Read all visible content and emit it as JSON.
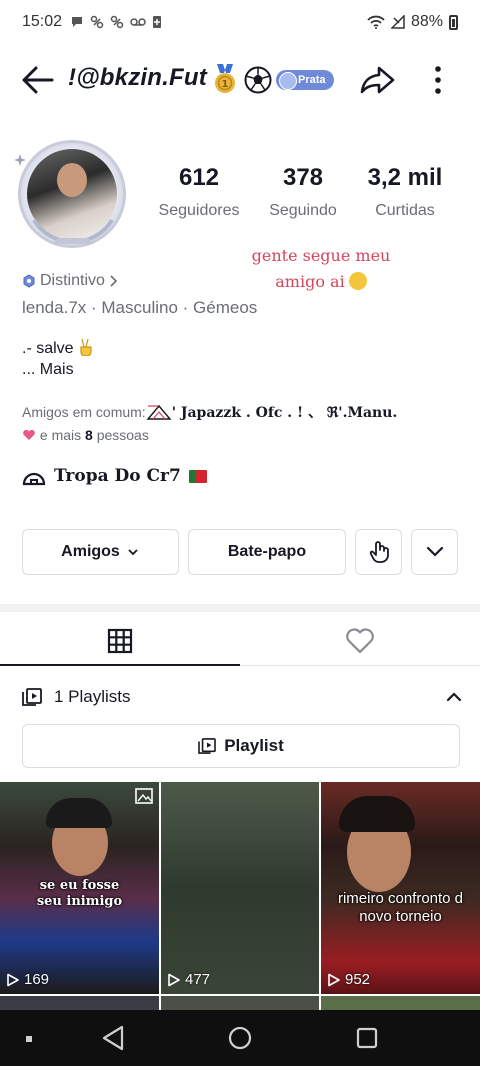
{
  "status_bar": {
    "time": "15:02",
    "notif_icons": [
      "chat-bubble-icon",
      "usb-icon",
      "usb-icon",
      "voicemail-icon",
      "battery-saver-icon"
    ],
    "battery": "88%"
  },
  "header": {
    "username": "!@bkzin.Fut",
    "rank_badge": "Prata"
  },
  "stats": [
    {
      "value": "612",
      "label": "Seguidores"
    },
    {
      "value": "378",
      "label": "Seguindo"
    },
    {
      "value": "3,2 mil",
      "label": "Curtidas"
    }
  ],
  "bio_note": {
    "line1": "gente segue meu",
    "line2": "amigo ai"
  },
  "distintivo": "Distintivo",
  "meta_line": "lenda.7x · Masculino · Gémeos",
  "bio": {
    "line1": ".- salve",
    "more": "...  Mais"
  },
  "mutual": {
    "prefix": "Amigos em comum:",
    "names": "' Japazzk . Ofc  . !       、 ℜ'.Manu.",
    "suffix_a": " e mais ",
    "count": "8",
    "suffix_b": " pessoas"
  },
  "group": {
    "name": "Tropa Do Cr7"
  },
  "buttons": {
    "friends": "Amigos",
    "chat": "Bate-papo"
  },
  "playlists": {
    "header": "1 Playlists",
    "button": "Playlist"
  },
  "videos": [
    {
      "caption": "se eu fosse seu inimigo",
      "views": "169",
      "pinned": true
    },
    {
      "caption": "",
      "views": "477",
      "pinned": false
    },
    {
      "caption": "rimeiro confronto d novo torneio",
      "views": "952",
      "pinned": false
    }
  ],
  "colors": {
    "accent_red": "#d6455c",
    "rank_blue": "#6f8ad9",
    "text_primary": "#161823",
    "text_secondary": "#6b6d75"
  }
}
